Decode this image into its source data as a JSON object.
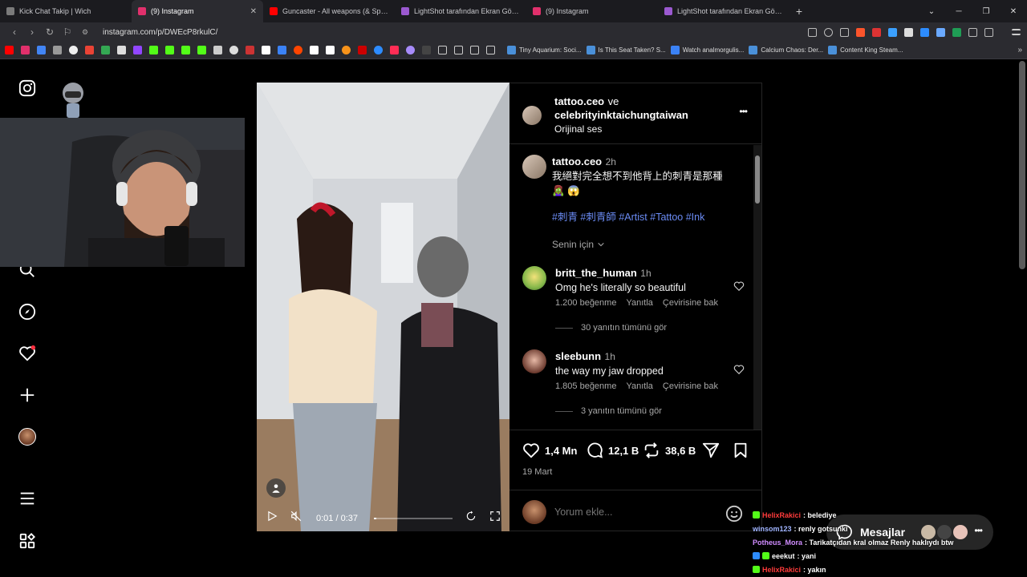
{
  "browser": {
    "tabs": [
      {
        "label": "Kick Chat Takip | Wich",
        "color": "#7a7a7a",
        "active": false
      },
      {
        "label": "(9) Instagram",
        "color": "#e1306c",
        "active": true
      },
      {
        "label": "Guncaster - All weapons (& Spells) sl",
        "color": "#ff0000",
        "active": false
      },
      {
        "label": "LightShot tarafından Ekran Görüntüsü",
        "color": "#9b59d0",
        "active": false
      },
      {
        "label": "(9) Instagram",
        "color": "#e1306c",
        "active": false
      },
      {
        "label": "LightShot tarafından Ekran Görüntüsü",
        "color": "#9b59d0",
        "active": false
      }
    ],
    "new_tab": "+",
    "url": "instagram.com/p/DWEcP8rkulC/",
    "bookmarks": [
      {
        "label": "Tiny Aquarium: Soci...",
        "color": "#4a90d9"
      },
      {
        "label": "Is This Seat Taken? S...",
        "color": "#4a90d9"
      },
      {
        "label": "Watch analmorgulis...",
        "color": "#3b82f6"
      },
      {
        "label": "Calcium Chaos: Der...",
        "color": "#4a90d9"
      },
      {
        "label": "Content King Steam...",
        "color": "#4a90d9"
      }
    ]
  },
  "post": {
    "header": {
      "author": "tattoo.ceo",
      "connector": "ve",
      "collaborator": "celebrityinktaichungtaiwan",
      "audio": "Orijinal ses",
      "more": "•••"
    },
    "caption": {
      "author": "tattoo.ceo",
      "time": "2h",
      "text": "我絕對完全想不到他背上的刺青是那種",
      "emoji": "🧟‍♀️ 😱",
      "hashtags": "#刺青 #刺青師 #Artist #Tattoo #Ink",
      "for_you": "Senin için"
    },
    "comments": [
      {
        "user": "britt_the_human",
        "time": "1h",
        "text": "Omg he's literally so beautiful",
        "likes": "1.200 beğenme",
        "reply": "Yanıtla",
        "translate": "Çevirisine bak",
        "replies": "30 yanıtın tümünü gör"
      },
      {
        "user": "sleebunn",
        "time": "1h",
        "text": "the way my jaw dropped",
        "likes": "1.805 beğenme",
        "reply": "Yanıtla",
        "translate": "Çevirisine bak",
        "replies": "3 yanıtın tümünü gör"
      }
    ],
    "stats": {
      "likes": "1,4 Mn",
      "comments": "12,1 B",
      "reposts": "38,6 B",
      "date": "19 Mart"
    },
    "add_comment_placeholder": "Yorum ekle...",
    "video": {
      "time": "0:01 / 0:37",
      "progress": 0.03
    }
  },
  "chat": {
    "lines": [
      {
        "user": "HelixRakici",
        "msg": ": belediye",
        "color": "#ff3b3b"
      },
      {
        "user": "winsom123",
        "msg": ": renly gotsunki",
        "color": "#a0b4ff"
      },
      {
        "user": "Potheus_Mora",
        "msg": ": Tarikatçıdan kral olmaz Renly haklıydı btw",
        "color": "#d08cff"
      },
      {
        "user": "eeekut",
        "msg": ": yani",
        "color": "#ffffff"
      },
      {
        "user": "HelixRakici",
        "msg": ": yakın",
        "color": "#ff3b3b"
      }
    ]
  },
  "messages": {
    "label": "Mesajlar",
    "badge": ""
  }
}
